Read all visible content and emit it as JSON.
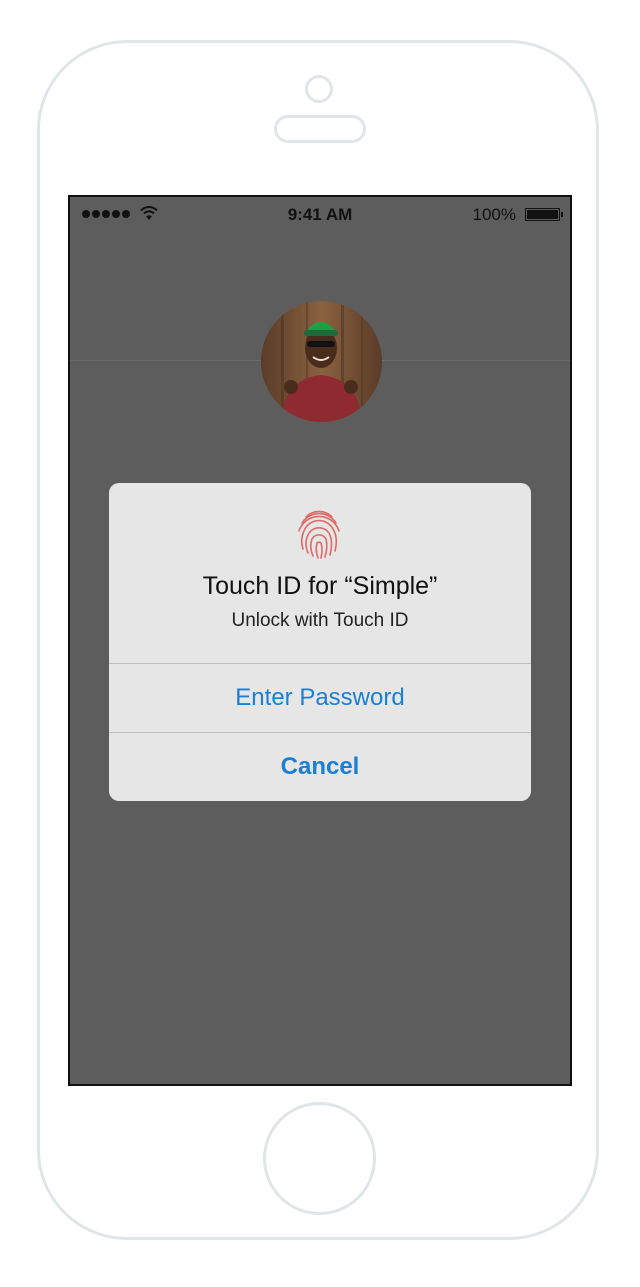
{
  "status_bar": {
    "time": "9:41 AM",
    "battery_percent": "100%",
    "signal_bars": 5,
    "wifi_icon": "wifi-icon"
  },
  "avatar": {
    "icon": "user-avatar"
  },
  "alert": {
    "icon": "fingerprint-icon",
    "title": "Touch ID for “Simple”",
    "message": "Unlock with Touch ID",
    "buttons": [
      {
        "label": "Enter Password"
      },
      {
        "label": "Cancel"
      }
    ],
    "accent_color": "#1a7fd6",
    "fingerprint_color": "#e06a66"
  },
  "colors": {
    "screen_overlay": "#5d5d5d",
    "alert_background": "#e6e6e6",
    "device_outline": "#e0e5e8"
  }
}
